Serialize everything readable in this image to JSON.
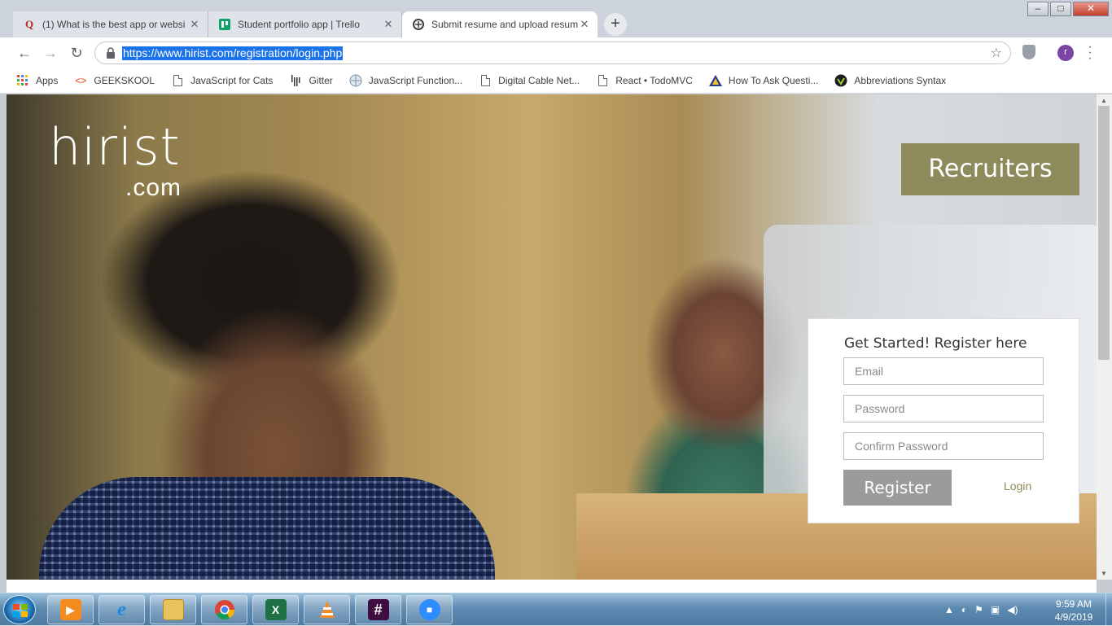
{
  "browser": {
    "tabs": [
      {
        "title": "(1) What is the best app or websi",
        "icon": "quora-icon",
        "active": false
      },
      {
        "title": "Student portfolio app | Trello",
        "icon": "trello-icon",
        "active": false
      },
      {
        "title": "Submit resume and upload resum",
        "icon": "hirist-icon",
        "active": true
      }
    ],
    "url": "https://www.hirist.com/registration/login.php",
    "profile_initial": "r",
    "bookmarks": [
      {
        "label": "Apps",
        "icon": "apps-grid-icon"
      },
      {
        "label": "GEEKSKOOL",
        "icon": "code-icon"
      },
      {
        "label": "JavaScript for Cats",
        "icon": "page-icon"
      },
      {
        "label": "Gitter",
        "icon": "gitter-icon"
      },
      {
        "label": "JavaScript Function...",
        "icon": "globe-icon"
      },
      {
        "label": "Digital Cable Net...",
        "icon": "page-icon"
      },
      {
        "label": "React • TodoMVC",
        "icon": "page-icon"
      },
      {
        "label": "How To Ask Questi...",
        "icon": "triangle-icon"
      },
      {
        "label": "Abbreviations Syntax",
        "icon": "shield-icon"
      }
    ]
  },
  "page": {
    "logo_main": "hirist",
    "logo_suffix": ".com",
    "recruiters_label": "Recruiters",
    "form": {
      "heading": "Get Started! Register here",
      "email_placeholder": "Email",
      "password_placeholder": "Password",
      "confirm_placeholder": "Confirm Password",
      "register_label": "Register",
      "login_label": "Login"
    },
    "colors": {
      "accent": "#8d8b5b",
      "button": "#9b9b9b"
    }
  },
  "taskbar": {
    "apps": [
      "media-player-icon",
      "internet-explorer-icon",
      "file-explorer-icon",
      "chrome-icon",
      "excel-icon",
      "vlc-icon",
      "slack-icon",
      "zoom-icon"
    ],
    "time": "9:59 AM",
    "date": "4/9/2019"
  }
}
